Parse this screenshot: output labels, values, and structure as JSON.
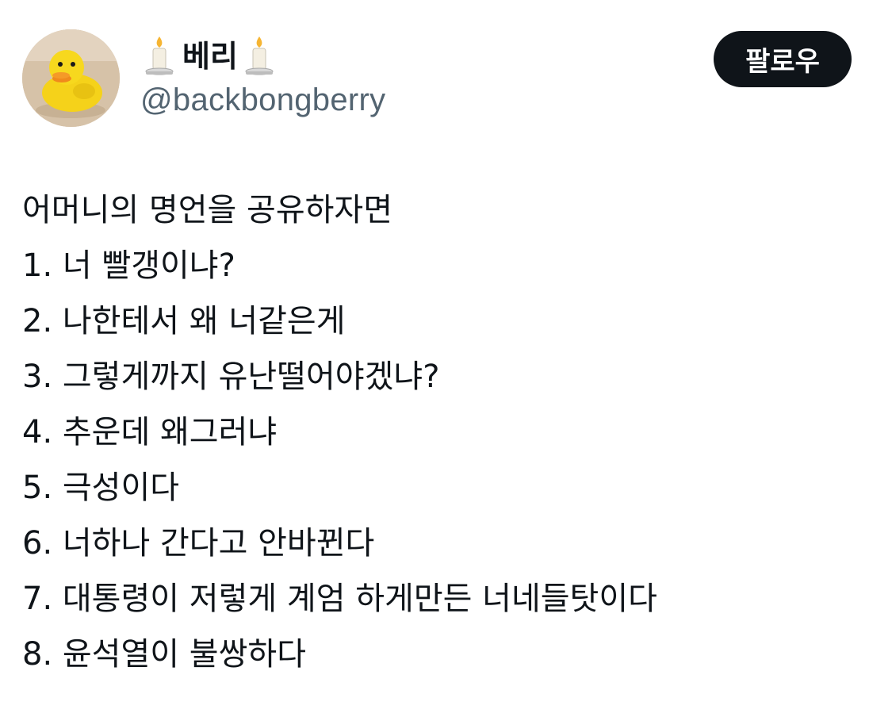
{
  "author": {
    "avatar_icon": "rubber-duck-avatar",
    "name_prefix_icon": "candle-icon",
    "display_name": "베리",
    "name_suffix_icon": "candle-icon",
    "handle": "@backbongberry"
  },
  "follow_button": {
    "label": "팔로우",
    "background": "#0f1419",
    "text_color": "#ffffff"
  },
  "tweet": {
    "lines": [
      "어머니의 명언을 공유하자면",
      "1. 너 빨갱이냐?",
      "2. 나한테서 왜 너같은게",
      "3. 그렇게까지 유난떨어야겠냐?",
      "4. 추운데 왜그러냐",
      "5. 극성이다",
      "6. 너하나 간다고 안바뀐다",
      "7. 대통령이 저렇게 계엄 하게만든 너네들탓이다",
      "8. 윤석열이 불쌍하다"
    ]
  },
  "colors": {
    "text_primary": "#0f1419",
    "text_secondary": "#536471",
    "background": "#ffffff"
  }
}
